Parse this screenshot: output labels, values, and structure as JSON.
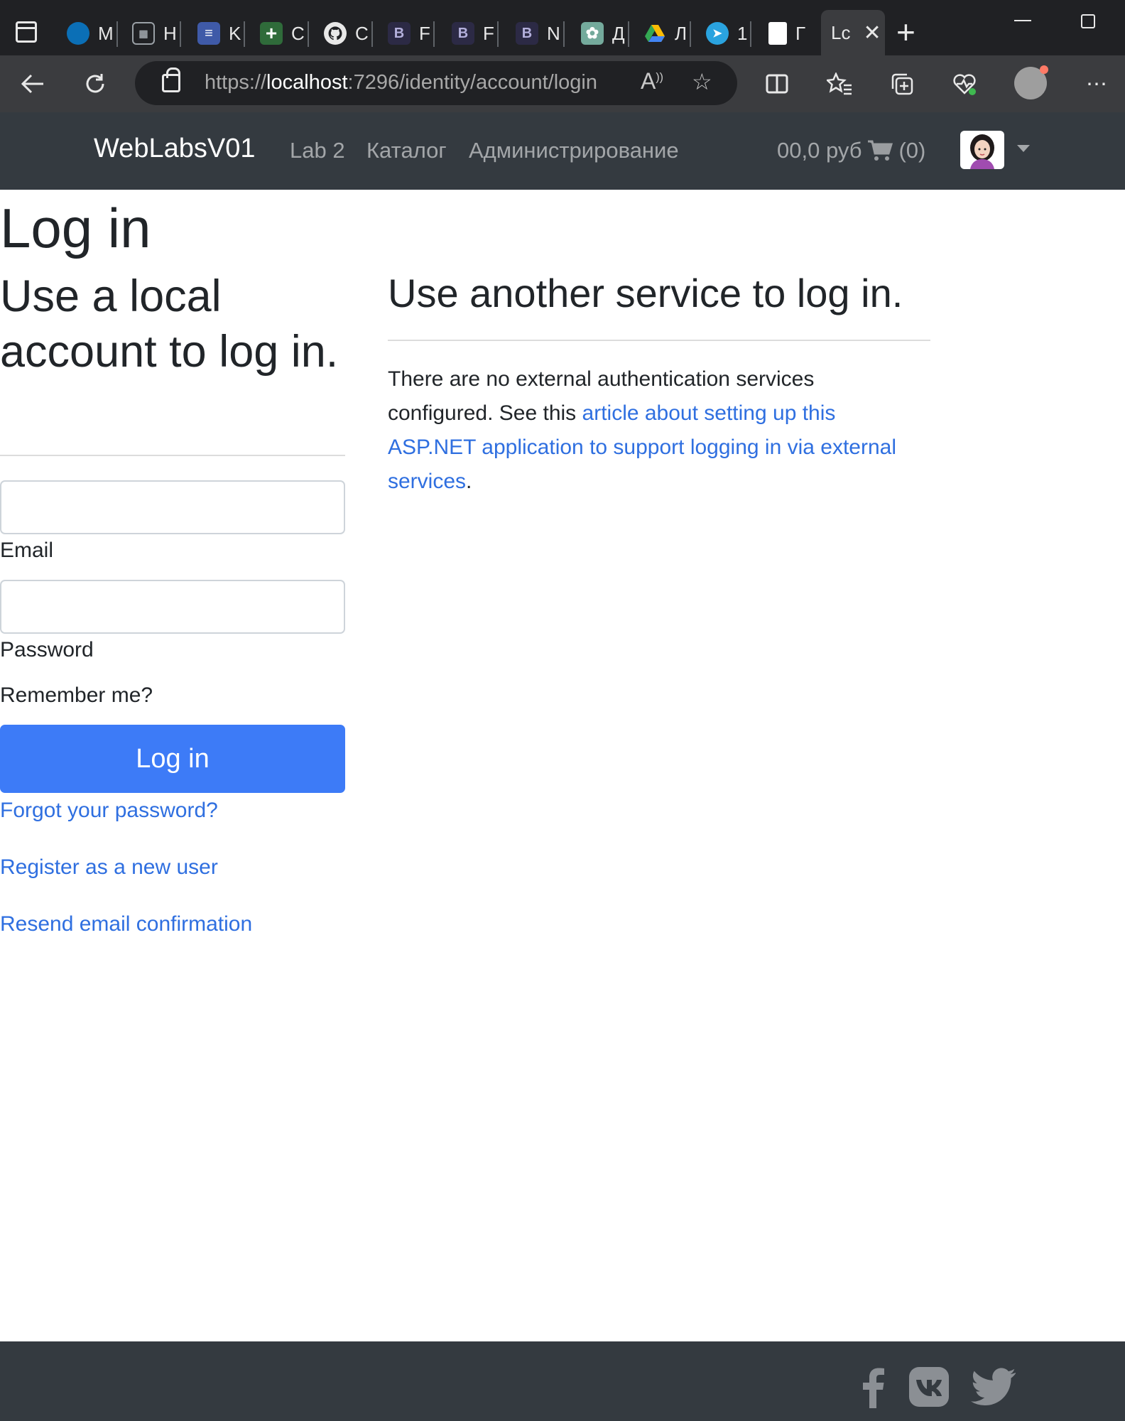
{
  "browser": {
    "tabs": [
      {
        "label": "M",
        "icon": "edge-icon",
        "color": "#0b6fb6"
      },
      {
        "label": "H",
        "icon": "calendar-icon",
        "color": "#3a3a3a"
      },
      {
        "label": "K",
        "icon": "document-icon",
        "color": "#3f5aa8"
      },
      {
        "label": "C",
        "icon": "sheet-icon",
        "color": "#2f6b3a"
      },
      {
        "label": "C",
        "icon": "github-icon",
        "color": "#202124"
      },
      {
        "label": "F",
        "icon": "b-icon",
        "color": "#2c2a45"
      },
      {
        "label": "F",
        "icon": "b-icon",
        "color": "#2c2a45"
      },
      {
        "label": "N",
        "icon": "b-icon",
        "color": "#2c2a45"
      },
      {
        "label": "Д",
        "icon": "openai-icon",
        "color": "#74aa9c"
      },
      {
        "label": "Л",
        "icon": "drive-icon",
        "color": "#202124"
      },
      {
        "label": "1",
        "icon": "telegram-icon",
        "color": "#2aa3df"
      },
      {
        "label": "Г",
        "icon": "file-icon",
        "color": "#202124"
      }
    ],
    "active_tab": {
      "label": "Lc",
      "close": "✕"
    },
    "new_tab": "+",
    "url": {
      "scheme": "https://",
      "host": "localhost",
      "rest": ":7296/identity/account/login"
    }
  },
  "navbar": {
    "brand": "WebLabsV01",
    "links": [
      "Lab 2",
      "Каталог",
      "Администрирование"
    ],
    "cart_amount": "00,0 руб",
    "cart_count": "(0)"
  },
  "login": {
    "title": "Log in",
    "local_heading": "Use a local account to log in.",
    "email_label": "Email",
    "email_value": "",
    "password_label": "Password",
    "password_value": "",
    "remember_label": "Remember me?",
    "submit_label": "Log in",
    "forgot_link": "Forgot your password?",
    "register_link": "Register as a new user",
    "resend_link": "Resend email confirmation"
  },
  "external": {
    "heading": "Use another service to log in.",
    "text_before": "There are no external authentication services configured. See this ",
    "link_text": "article about setting up this ASP.NET application to support logging in via external services",
    "text_after": "."
  },
  "colors": {
    "navbar": "#343a40",
    "primary": "#3d7bf7",
    "link": "#2f6fe0"
  }
}
